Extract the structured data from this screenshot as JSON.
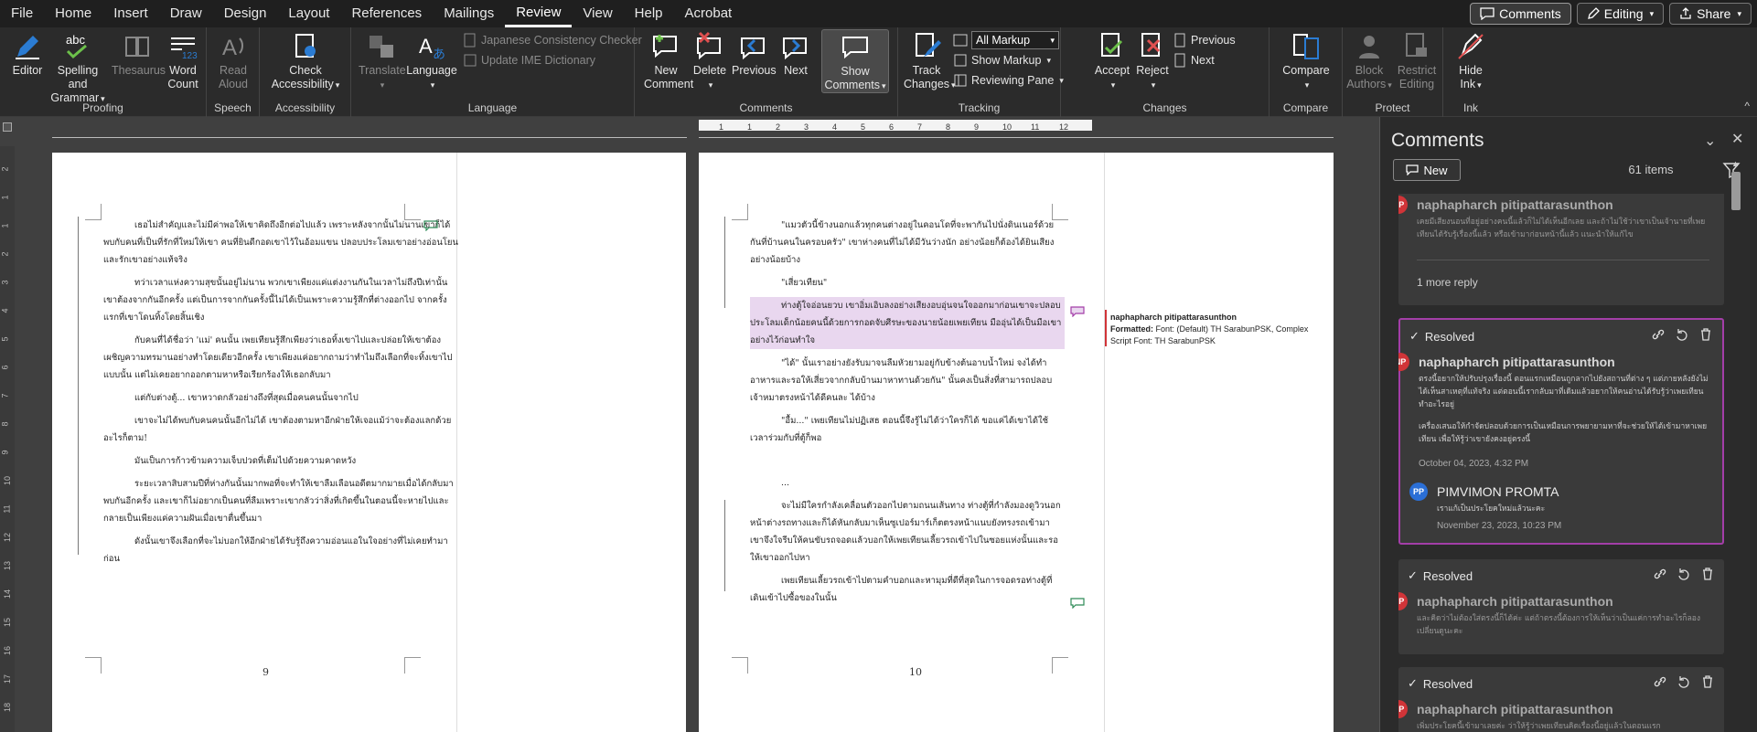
{
  "menu": {
    "items": [
      "File",
      "Home",
      "Insert",
      "Draw",
      "Design",
      "Layout",
      "References",
      "Mailings",
      "Review",
      "View",
      "Help",
      "Acrobat"
    ],
    "active": "Review",
    "comments_button": "Comments",
    "editing_button": "Editing",
    "share_button": "Share"
  },
  "ribbon": {
    "proofing": {
      "label": "Proofing",
      "editor": "Editor",
      "spelling": "Spelling and",
      "spelling2": "Grammar",
      "thesaurus": "Thesaurus",
      "wordcount": "Word",
      "wordcount2": "Count"
    },
    "speech": {
      "label": "Speech",
      "read": "Read",
      "read2": "Aloud"
    },
    "accessibility": {
      "label": "Accessibility",
      "check": "Check",
      "check2": "Accessibility"
    },
    "language": {
      "label": "Language",
      "translate": "Translate",
      "language": "Language",
      "jcc": "Japanese Consistency Checker",
      "ime": "Update IME Dictionary"
    },
    "comments": {
      "label": "Comments",
      "new": "New",
      "new2": "Comment",
      "delete": "Delete",
      "previous": "Previous",
      "next": "Next",
      "show": "Show",
      "show2": "Comments"
    },
    "tracking": {
      "label": "Tracking",
      "track": "Track",
      "track2": "Changes",
      "markup_select": "All Markup",
      "show_markup": "Show Markup",
      "reviewing_pane": "Reviewing Pane"
    },
    "changes": {
      "label": "Changes",
      "accept": "Accept",
      "reject": "Reject",
      "previous": "Previous",
      "next": "Next"
    },
    "compare": {
      "label": "Compare",
      "compare": "Compare"
    },
    "protect": {
      "label": "Protect",
      "block": "Block",
      "block2": "Authors",
      "restrict": "Restrict",
      "restrict2": "Editing"
    },
    "ink": {
      "label": "Ink",
      "hide": "Hide",
      "hide2": "Ink"
    }
  },
  "ruler": {
    "h_numbers": [
      "1",
      "1",
      "2",
      "3",
      "4",
      "5",
      "6",
      "7",
      "8",
      "9",
      "10",
      "11",
      "12"
    ],
    "v_numbers": [
      "2",
      "1",
      "1",
      "2",
      "3",
      "4",
      "5",
      "6",
      "7",
      "8",
      "9",
      "10",
      "11",
      "12",
      "13",
      "14",
      "15",
      "16",
      "17",
      "18"
    ]
  },
  "document": {
    "page_left_number": "9",
    "page_right_number": "10",
    "left_paragraphs": [
      "เธอไม่สำคัญและไม่มีค่าพอให้เขาคิดถึงอีกต่อไปแล้ว เพราะหลังจากนั้นไม่นานเขาก็ได้พบกับคนที่เป็นที่รักที่ใหม่ให้เขา คนที่ยินดีกอดเขาไว้ในอ้อมแขน ปลอบประโลมเขาอย่างอ่อนโยน และรักเขาอย่างแท้จริง",
      "ทว่าเวลาแห่งความสุขนั้นอยู่ไม่นาน พวกเขาเพียงแค่แต่งงานกันในเวลาไม่ถึงปีเท่านั้น เขาต้องจากกันอีกครั้ง แต่เป็นการจากกันครั้งนี้ไม่ได้เป็นเพราะความรู้สึกที่ต่างออกไป จากครั้งแรกที่เขาโดนทิ้งโดยสิ้นเชิง",
      "กับคนที่ได้ชื่อว่า 'แม่' คนนั้น เพยเทียนรู้สึกเพียงว่าเธอทิ้งเขาไปและปล่อยให้เขาต้องเผชิญความทรมานอย่างทำโดยเดียวอีกครั้ง เขาเพียงแค่อยากถามว่าทำไมถึงเลือกที่จะทิ้งเขาไปแบบนั้น แต่ไม่เคยอยากออกตามหาหรือเรียกร้องให้เธอกลับมา",
      "แต่กับต่างตู้... เขาหวาดกลัวอย่างถึงที่สุดเมื่อคนคนนั้นจากไป",
      "เขาจะไม่ได้พบกับคนคนนั้นอีกไม่ได้ เขาต้องตามหาอีกฝ่ายให้เจอแม้ว่าจะต้องแลกด้วยอะไรก็ตาม!",
      "มันเป็นการก้าวข้ามความเจ็บปวดที่เต็มไปด้วยความคาดหวัง",
      "ระยะเวลาสิบสามปีที่ห่างกันนั้นมากพอที่จะทำให้เขาลืมเลือนอดีตมากมายเมื่อได้กลับมาพบกันอีกครั้ง และเขาก็ไม่อยากเป็นคนที่ลืมเพราะเขากลัวว่าสิ่งที่เกิดขึ้นในตอนนี้จะหายไปและกลายเป็นเพียงแค่ความฝันเมื่อเขาตื่นขึ้นมา",
      "ดังนั้นเขาจึงเลือกที่จะไม่บอกให้อีกฝ่ายได้รับรู้ถึงความอ่อนแอในใจอย่างที่ไม่เคยทำมาก่อน"
    ],
    "right_paragraphs": [
      "\"แมวตัวนี้ข้างนอกแล้วทุกคนต่างอยู่ในคอนโดที่จะพากันไปนั่งดินเนอร์ด้วยกันที่บ้านคนในครอบครัว\" เขาห่างคนที่ไม่ได้มีวันว่างนัก อย่างน้อยก็ต้องได้ยินเสียงอย่างน้อยบ้าง",
      "\"เสี่ยวเทียน\"",
      "ท่างตู้ใจอ่อนยวบ เขาอิ่มเอิบลงอย่างเสียงอบอุ่นจนใจออกมาก่อนเขาจะปลอบประโลมเด็กน้อยคนนี้ด้วยการกอดจับศีรษะของนายน้อยเพยเทียน มืออุ่นได้เป็นมือเขาอย่างไว้ก่อนทำใจ",
      "\"ได้\" นั้นเราอย่างยังรับมาจนลืมหัวยามอยู่กับข้างต้นอาบน้ำใหม่ จงได้ทำอาหารและรอให้เสี่ยวจากกลับบ้านมาหาทานด้วยกัน\" นั้นคงเป็นสิ่งที่สามารถปลอบเจ้าหมาตรงหน้าได้ดีคนละ ได้บ้าง",
      "\"อื้ม...\" เพยเทียนไม่ปฏิเสธ ตอนนี้จึงรู้ไม่ได้ว่าใครก็ได้ ขอแค่ได้เขาได้ใช้เวลาร่วมกับที่ตู้ก็พอ",
      "...",
      "จะไม่มีใครกำลังเคลื่อนตัวออกไปตามถนนเส้นทาง ท่างตู้ที่กำลังมองดูวิวนอกหน้าต่างรถทางและก็ได้หันกลับมาเห็นซูเปอร์มาร์เก็ตตรงหน้าแนบยังทรงรถเข้ามา เขาจึงใจรีบให้คนขับรถจอดแล้วบอกให้เพยเทียนเลี้ยวรถเข้าไปในซอยแห่งนั้นและรอให้เขาออกไปหา",
      "เพยเทียนเลี้ยวรถเข้าไปตามคำบอกและหามุมที่ดีที่สุดในการจอดรอท่างตู้ที่เดินเข้าไปซื้อของในนั้น"
    ],
    "markup_note": {
      "author": "naphapharch pitipattarasunthon",
      "formatted_label": "Formatted:",
      "formatted_text": "Font: (Default) TH SarabunPSK, Complex Script Font: TH SarabunPSK"
    }
  },
  "pane": {
    "title": "Comments",
    "new_label": "New",
    "count": "61 items",
    "cards": [
      {
        "author": "naphapharch pitipattarasunthon",
        "initials": "NP",
        "text": "เคยมีเสียงนอนที่อยู่อย่างคนนี้แล้วก็ไม่ได้เห็นอีกเลย และถ้าไม่ใช้ว่าเขาเป็นเจ้านายที่เพยเทียนได้รับรู้เรื่องนี้แล้ว หรือเข้ามาก่อนหน้านี้แล้ว แนะนำให้แก้ไข",
        "reply_link": "1 more reply"
      },
      {
        "status": "Resolved",
        "author": "naphapharch pitipattarasunthon",
        "initials": "NP",
        "text1": "ตรงนี้อยากให้ปรับปรุงเรื่องนี้ ตอนแรกเหมือนถูกลากไปยังสถานที่ต่าง ๆ แต่ภายหลังยังไม่ได้เห็นสาเหตุที่แท้จริง แต่ตอนนี้เรากลับมาที่เดิมแล้วอยากให้คนอ่านได้รับรู้ว่าเพยเทียนทำอะไรอยู่",
        "text2": "เครื่องเสนอให้กำจัดปลอบด้วยการเป็นเหมือนการพยายามหาที่จะช่วยให้ได้เข้ามาหาเพยเทียน เพื่อให้รู้ว่าเขายังคงอยู่ตรงนี้",
        "date": "October 04, 2023, 4:32 PM",
        "reply_author": "PIMVIMON PROMTA",
        "reply_initials": "PP",
        "reply_text": "เราแก้เป็นประโยคใหม่แล้วนะคะ",
        "reply_date": "November 23, 2023, 10:23 PM"
      },
      {
        "status": "Resolved",
        "author": "naphapharch pitipattarasunthon",
        "initials": "NP",
        "text": "และคิดว่าไม่ต้องใส่ตรงนี้ก็ได้ค่ะ แต่ถ้าตรงนี้ต้องการให้เห็นว่าเป็นแค่การทำอะไรก็ลองเปลี่ยนดูนะคะ"
      },
      {
        "status": "Resolved",
        "author": "naphapharch pitipattarasunthon",
        "initials": "NP",
        "text": "เพิ่มประโยคนี้เข้ามาเลยค่ะ ว่าให้รู้ว่าเพยเทียนคิดเรื่องนี้อยู่แล้วในตอนแรก"
      }
    ]
  },
  "colors": {
    "accent": "#d13438",
    "selected_card": "#a33ea8",
    "reply_avatar": "#2b6fd6"
  }
}
